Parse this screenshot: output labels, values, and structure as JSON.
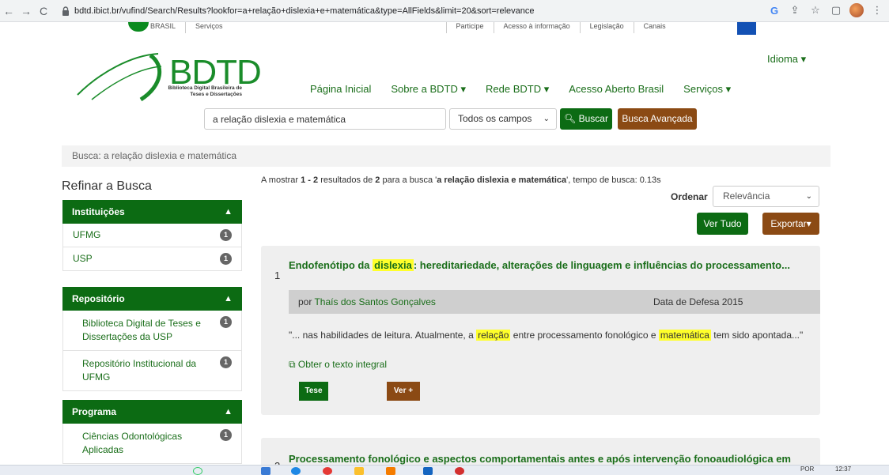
{
  "browser": {
    "url": "bdtd.ibict.br/vufind/Search/Results?lookfor=a+relação+dislexia+e+matemática&type=AllFields&limit=20&sort=relevance"
  },
  "govbar": {
    "items": [
      "BRASIL",
      "Serviços",
      "Participe",
      "Acesso à informação",
      "Legislação",
      "Canais"
    ]
  },
  "header": {
    "logo_text": "BDTD",
    "logo_sub": "Biblioteca Digital Brasileira de Teses e Dissertações",
    "idioma": "Idioma ▾",
    "nav": [
      "Página Inicial",
      "Sobre a BDTD ▾",
      "Rede BDTD ▾",
      "Acesso Aberto Brasil",
      "Serviços ▾"
    ]
  },
  "search": {
    "query": "a relação dislexia e matemática",
    "field": "Todos os campos",
    "buscar": "Buscar",
    "avancada": "Busca Avançada"
  },
  "breadcrumb": "Busca: a relação dislexia e matemática",
  "sidebar": {
    "title": "Refinar a Busca",
    "facets": [
      {
        "title": "Instituições",
        "items": [
          {
            "label": "UFMG",
            "count": "1"
          },
          {
            "label": "USP",
            "count": "1"
          }
        ]
      },
      {
        "title": "Repositório",
        "items": [
          {
            "label": "Biblioteca Digital de Teses e Dissertações da USP",
            "count": "1"
          },
          {
            "label": "Repositório Institucional da UFMG",
            "count": "1"
          }
        ]
      },
      {
        "title": "Programa",
        "items": [
          {
            "label": "Ciências Odontológicas Aplicadas",
            "count": "1"
          }
        ]
      }
    ]
  },
  "results_header": {
    "summary_prefix": "A mostrar ",
    "range": "1 - 2",
    "summary_mid": " resultados de ",
    "total": "2",
    "summary_mid2": " para a busca '",
    "query": "a relação dislexia e matemática",
    "summary_suffix": "', tempo de busca: 0.13s",
    "ordenar_label": "Ordenar",
    "ordenar_value": "Relevância",
    "ver_tudo": "Ver Tudo",
    "exportar": "Exportar▾"
  },
  "results": [
    {
      "num": "1",
      "title_before": "Endofenótipo da ",
      "title_hl": "dislexia",
      "title_after": ": hereditariedade, alterações de linguagem e influências do processamento...",
      "by": "por ",
      "author": "Thaís dos Santos Gonçalves",
      "date_label": "Data de Defesa 2015",
      "snippet_1": "\"... nas habilidades de leitura. Atualmente, a ",
      "snippet_hl1": "relação",
      "snippet_2": " entre processamento fonológico e ",
      "snippet_hl2": "matemática",
      "snippet_3": " tem sido apontada...\"",
      "fulltext": "Obter o texto integral",
      "type_button": "Tese",
      "more_button": "Ver +"
    },
    {
      "num": "2",
      "title": "Processamento fonológico e aspectos comportamentais antes e após intervenção fonoaudiológica em"
    }
  ],
  "taskbar": {
    "lang": "POR",
    "time": "12:37"
  }
}
